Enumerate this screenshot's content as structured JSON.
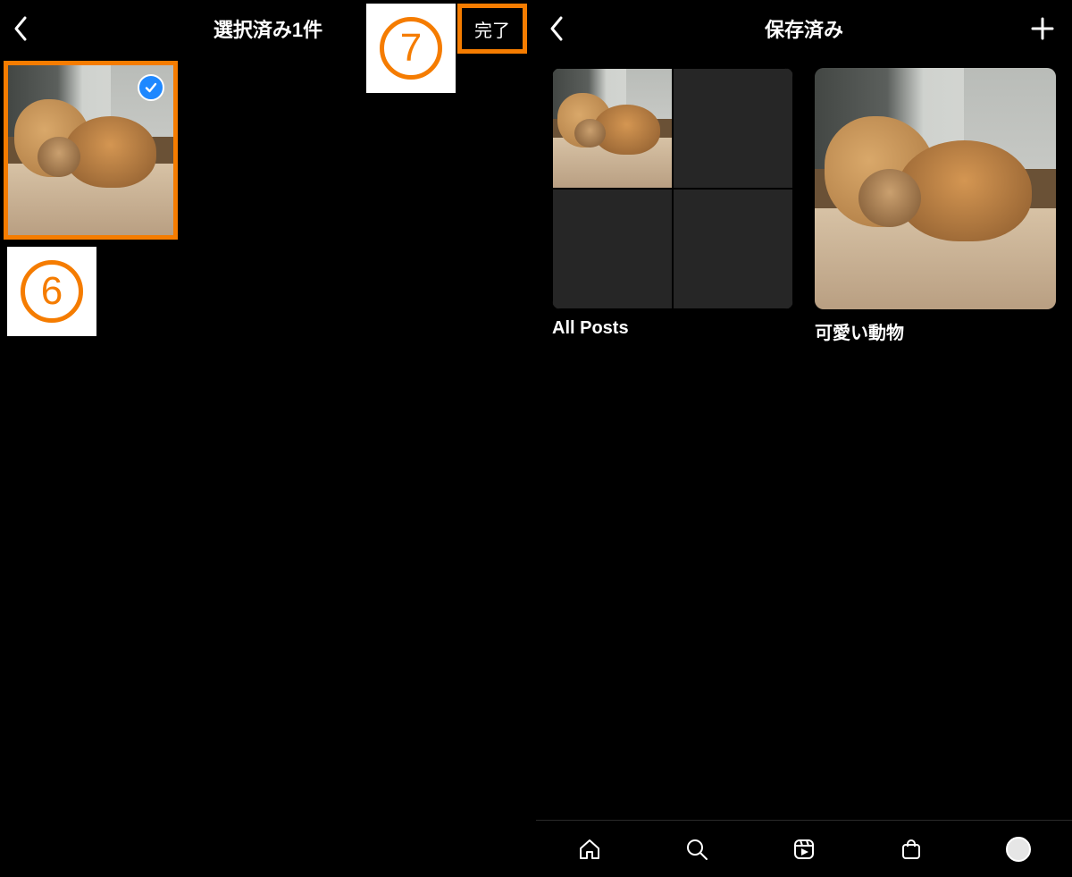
{
  "left": {
    "title": "選択済み1件",
    "done_label": "完了",
    "callouts": {
      "six": "6",
      "seven": "7"
    },
    "thumb_alt": "shiba-photo",
    "selected": true
  },
  "right": {
    "title": "保存済み",
    "collections": [
      {
        "label": "All Posts"
      },
      {
        "label": "可愛い動物"
      }
    ],
    "nav": {
      "home": "home-icon",
      "search": "search-icon",
      "reels": "reels-icon",
      "shop": "shop-icon",
      "profile": "profile-avatar"
    }
  }
}
